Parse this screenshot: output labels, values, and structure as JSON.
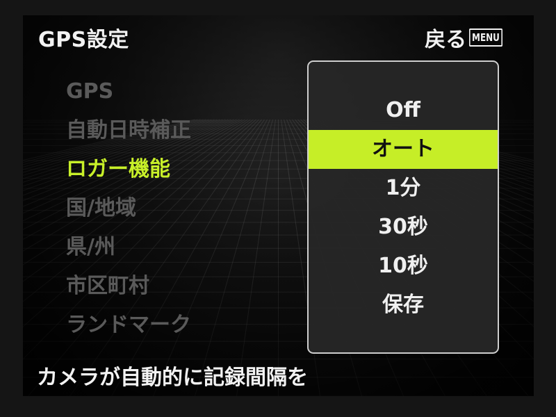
{
  "header": {
    "title": "GPS設定",
    "back_label": "戻る",
    "menu_badge": "MENU"
  },
  "menu": {
    "items": [
      {
        "label": "GPS",
        "state": "dim"
      },
      {
        "label": "自動日時補正",
        "state": "dim"
      },
      {
        "label": "ロガー機能",
        "state": "active"
      },
      {
        "label": "国/地域",
        "state": "dim"
      },
      {
        "label": "県/州",
        "state": "dim"
      },
      {
        "label": "市区町村",
        "state": "dim"
      },
      {
        "label": "ランドマーク",
        "state": "dim"
      }
    ]
  },
  "popup": {
    "options": [
      {
        "label": "Off",
        "selected": false
      },
      {
        "label": "オート",
        "selected": true
      },
      {
        "label": "1分",
        "selected": false
      },
      {
        "label": "30秒",
        "selected": false
      },
      {
        "label": "10秒",
        "selected": false
      },
      {
        "label": "保存",
        "selected": false
      }
    ]
  },
  "footer": {
    "help_text": "カメラが自動的に記録間隔を"
  },
  "colors": {
    "accent": "#c6ee27",
    "active_text": "#c8f029",
    "dim_text": "#5a5a5a",
    "background": "#151515"
  }
}
